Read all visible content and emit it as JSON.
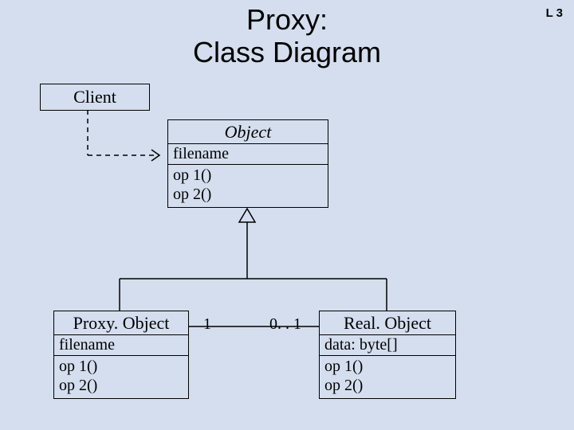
{
  "meta": {
    "slide_number": "L 3",
    "title_line1": "Proxy:",
    "title_line2": "Class Diagram"
  },
  "classes": {
    "client": {
      "name": "Client"
    },
    "object": {
      "name": "Object",
      "attr1": "filename",
      "op1": "op 1()",
      "op2": "op 2()"
    },
    "proxy": {
      "name": "Proxy. Object",
      "attr1": "filename",
      "op1": "op 1()",
      "op2": "op 2()"
    },
    "real": {
      "name": "Real. Object",
      "attr1": "data: byte[]",
      "op1": "op 1()",
      "op2": "op 2()"
    }
  },
  "multiplicity": {
    "proxy_side": "1",
    "real_side": "0. . 1"
  },
  "chart_data": {
    "type": "table",
    "description": "UML class diagram for Proxy pattern",
    "classes": [
      {
        "name": "Client",
        "attributes": [],
        "operations": []
      },
      {
        "name": "Object",
        "abstract": true,
        "attributes": [
          "filename"
        ],
        "operations": [
          "op1()",
          "op2()"
        ]
      },
      {
        "name": "Proxy.Object",
        "attributes": [
          "filename"
        ],
        "operations": [
          "op1()",
          "op2()"
        ]
      },
      {
        "name": "Real.Object",
        "attributes": [
          "data: byte[]"
        ],
        "operations": [
          "op1()",
          "op2()"
        ]
      }
    ],
    "relationships": [
      {
        "from": "Client",
        "to": "Object",
        "type": "dependency"
      },
      {
        "from": "Proxy.Object",
        "to": "Object",
        "type": "generalization"
      },
      {
        "from": "Real.Object",
        "to": "Object",
        "type": "generalization"
      },
      {
        "from": "Proxy.Object",
        "to": "Real.Object",
        "type": "association",
        "from_mult": "1",
        "to_mult": "0..1"
      }
    ]
  }
}
